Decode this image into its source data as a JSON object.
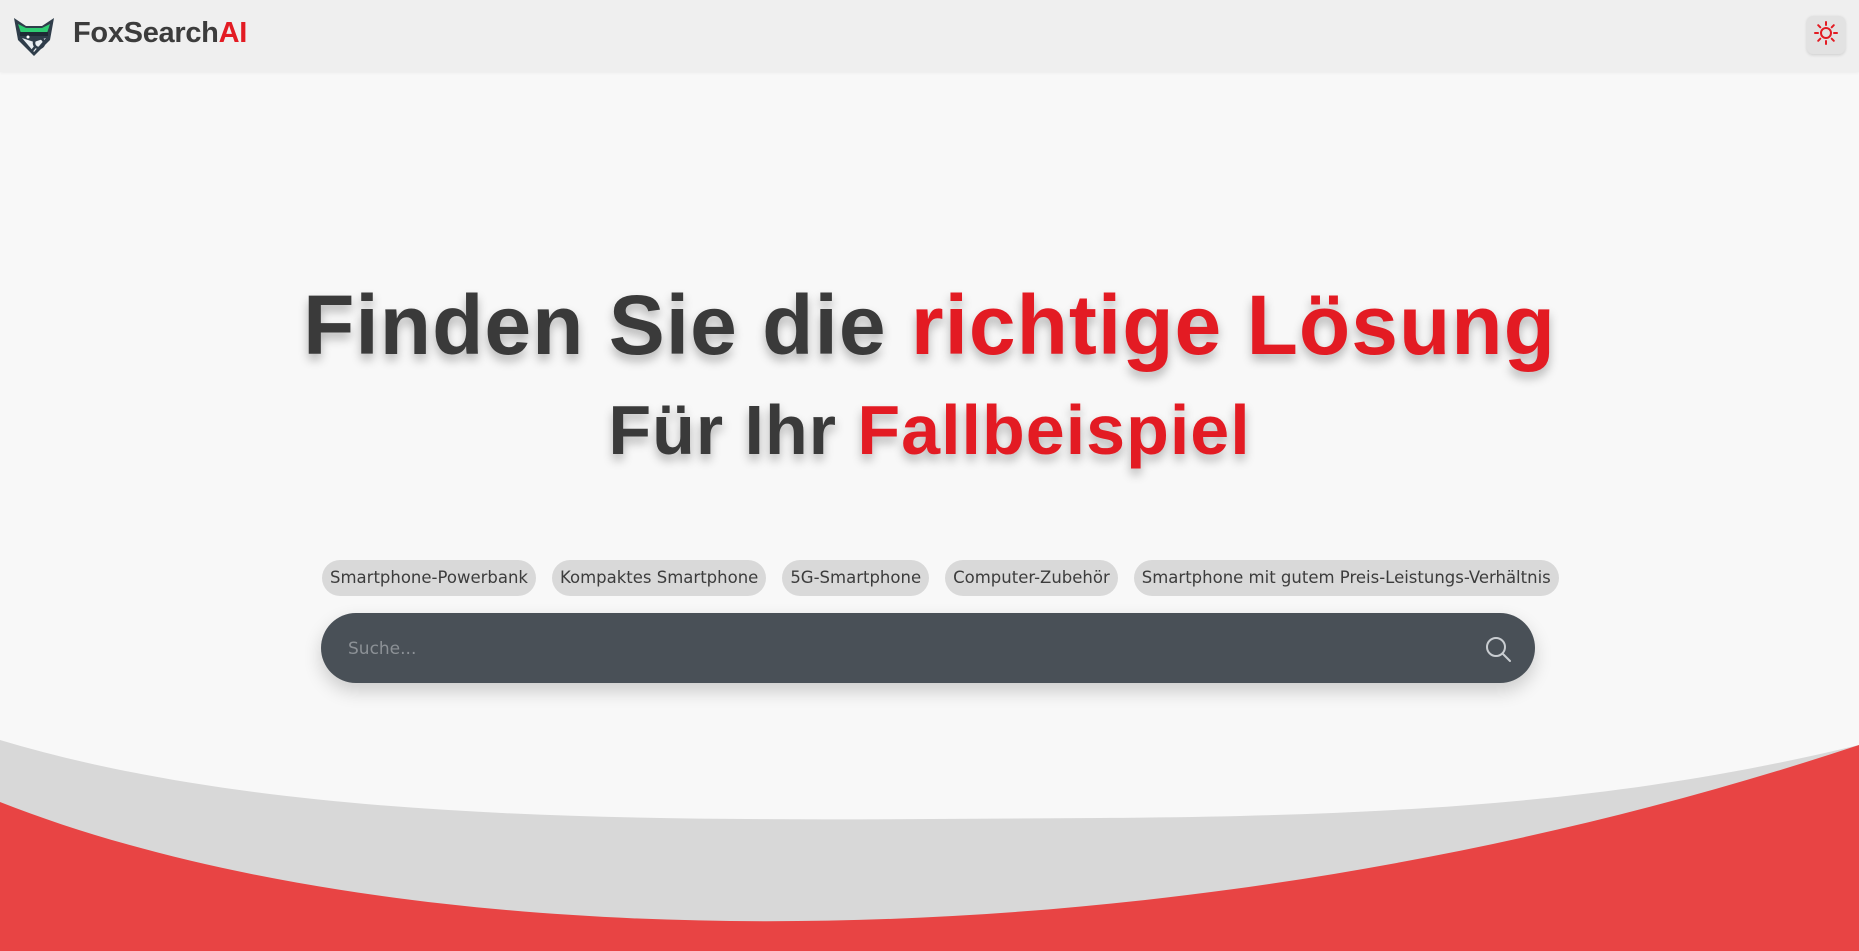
{
  "header": {
    "brand_main": "FoxSearch",
    "brand_accent": "AI",
    "logo_icon": "fox-logo-icon",
    "theme_icon": "sun-icon"
  },
  "hero": {
    "headline_plain": "Finden Sie die ",
    "headline_highlight": "richtige Lösung",
    "subline_plain": "Für Ihr ",
    "subline_highlight": "Fallbeispiel"
  },
  "suggestions": [
    "Smartphone-Powerbank",
    "Kompaktes Smartphone",
    "5G-Smartphone",
    "Computer-Zubehör",
    "Smartphone mit gutem Preis-Leistungs-Verhältnis"
  ],
  "search": {
    "placeholder": "Suche...",
    "value": "",
    "icon": "search-icon"
  },
  "colors": {
    "accent": "#e31b23",
    "text_dark": "#3a3a3a",
    "search_bg": "#495057",
    "wave_red": "#e84444",
    "wave_gray": "#d8d8d8"
  }
}
